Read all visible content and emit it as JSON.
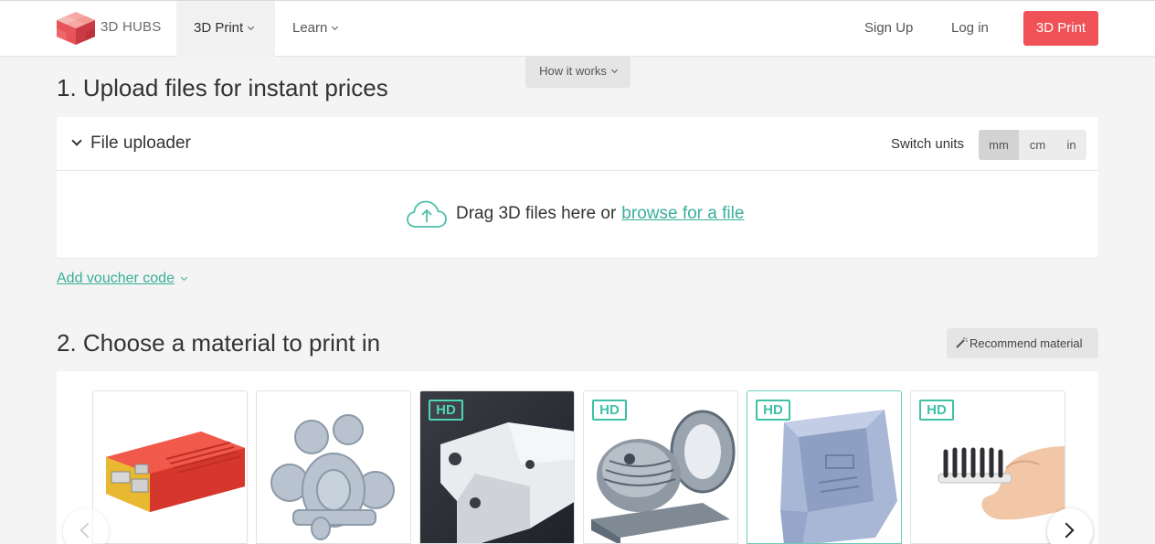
{
  "header": {
    "brand": "3D HUBS",
    "nav": [
      {
        "label": "3D Print"
      },
      {
        "label": "Learn"
      }
    ],
    "signup": "Sign Up",
    "login": "Log in",
    "cta": "3D Print",
    "how_it_works": "How it works"
  },
  "upload": {
    "heading": "1. Upload files for instant prices",
    "panel_title": "File uploader",
    "switch_units_label": "Switch units",
    "units": [
      "mm",
      "cm",
      "in"
    ],
    "selected_unit": "mm",
    "drop_text": "Drag 3D files here or",
    "browse_link": "browse for a file",
    "voucher": "Add voucher code"
  },
  "materials": {
    "heading": "2. Choose a material to print in",
    "recommend": "Recommend material",
    "hd_badge": "HD",
    "tiles": [
      {
        "name": "red-case",
        "hd": false
      },
      {
        "name": "gear-model",
        "hd": false
      },
      {
        "name": "white-bracket",
        "hd": true
      },
      {
        "name": "ball-joint",
        "hd": true
      },
      {
        "name": "blue-housing",
        "hd": true
      },
      {
        "name": "brush-print",
        "hd": true
      }
    ]
  },
  "colors": {
    "accent": "#f05156",
    "teal": "#3aaf9b"
  }
}
